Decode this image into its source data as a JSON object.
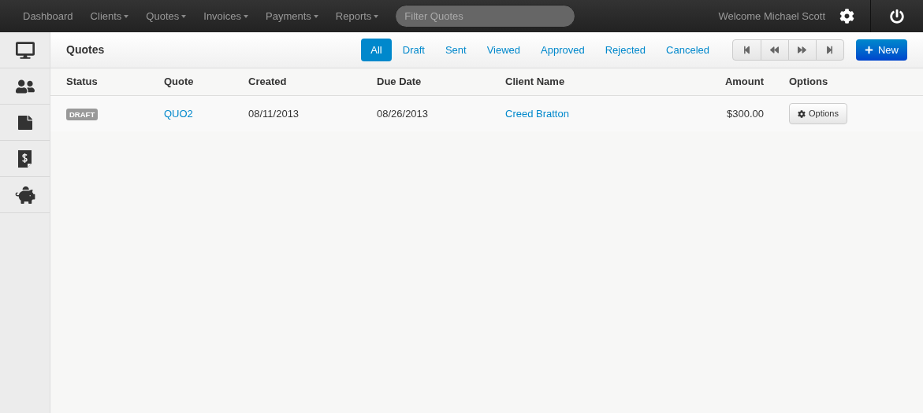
{
  "nav": {
    "items": [
      {
        "label": "Dashboard",
        "dropdown": false
      },
      {
        "label": "Clients",
        "dropdown": true
      },
      {
        "label": "Quotes",
        "dropdown": true
      },
      {
        "label": "Invoices",
        "dropdown": true
      },
      {
        "label": "Payments",
        "dropdown": true
      },
      {
        "label": "Reports",
        "dropdown": true
      }
    ],
    "search": {
      "placeholder": "Filter Quotes"
    },
    "welcome": "Welcome Michael Scott"
  },
  "header": {
    "title": "Quotes",
    "filters": [
      {
        "label": "All",
        "selected": true
      },
      {
        "label": "Draft",
        "selected": false
      },
      {
        "label": "Sent",
        "selected": false
      },
      {
        "label": "Viewed",
        "selected": false
      },
      {
        "label": "Approved",
        "selected": false
      },
      {
        "label": "Rejected",
        "selected": false
      },
      {
        "label": "Canceled",
        "selected": false
      }
    ],
    "new_button": "New"
  },
  "table": {
    "columns": [
      "Status",
      "Quote",
      "Created",
      "Due Date",
      "Client Name",
      "Amount",
      "Options"
    ],
    "rows": [
      {
        "status": "DRAFT",
        "quote": "QUO2",
        "created": "08/11/2013",
        "due_date": "08/26/2013",
        "client": "Creed Bratton",
        "amount": "$300.00",
        "options": "Options"
      }
    ]
  }
}
